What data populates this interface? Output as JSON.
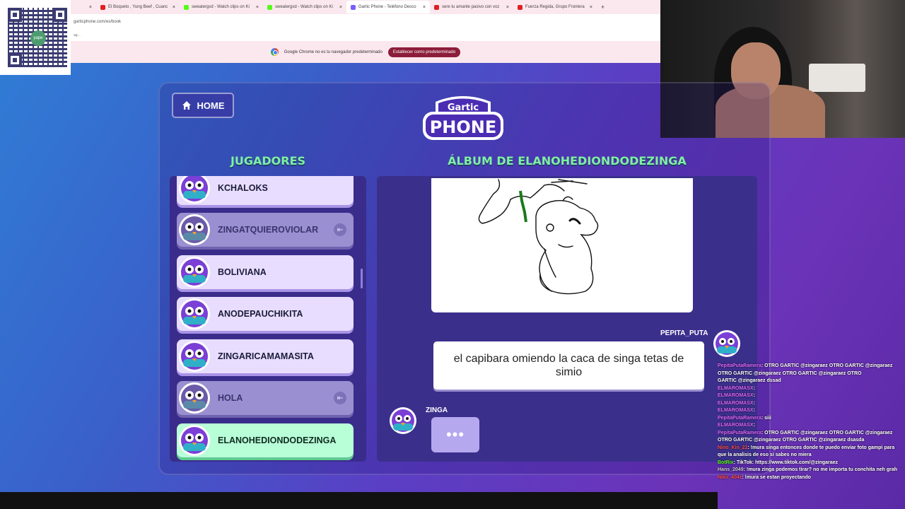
{
  "browser": {
    "tabs": [
      {
        "label": "",
        "active": false,
        "fav": "#888"
      },
      {
        "label": "El Boqueto , Yung Beef , Cuanc",
        "active": false,
        "fav": "#e02020"
      },
      {
        "label": "sweatergxd - Watch clips on Ki",
        "active": false,
        "fav": "#53fc18"
      },
      {
        "label": "sweatergxd - Watch clips on Ki",
        "active": false,
        "fav": "#53fc18"
      },
      {
        "label": "Gartic Phone - Teléfono Desco",
        "active": true,
        "fav": "#7b5cff"
      },
      {
        "label": "sere tu amante pasivo con voz",
        "active": false,
        "fav": "#e02020"
      },
      {
        "label": "Fuerza Regida, Grupo Frontera",
        "active": false,
        "fav": "#e02020"
      }
    ],
    "new_tab": "+",
    "url": "garticphone.com/es/book",
    "bookmarks": "ag...",
    "infobar": {
      "message": "Google Chrome no es tu navegador predeterminado",
      "button": "Establecer como predeterminado"
    }
  },
  "qr": {
    "logo_text": "yape"
  },
  "game": {
    "home_label": "HOME",
    "logo_top": "Gartic",
    "logo_bottom": "PHONE",
    "players_title": "JUGADORES",
    "album_title": "ÁLBUM DE ELANOHEDIONDODEZINGA",
    "players": [
      {
        "name": "KCHALOKS",
        "state": "active"
      },
      {
        "name": "ZINGATQUIEROVIOLAR",
        "state": "left"
      },
      {
        "name": "BOLIVIANA",
        "state": "active"
      },
      {
        "name": "ANODEPAUCHIKITA",
        "state": "active"
      },
      {
        "name": "ZINGARICAMAMASITA",
        "state": "active"
      },
      {
        "name": "HOLA",
        "state": "left"
      },
      {
        "name": "ELANOHEDIONDODEZINGA",
        "state": "me"
      }
    ],
    "exit_icon_label": "⇤",
    "messages": [
      {
        "author": "PEPITA_PUTA",
        "text": "el capibara omiendo la caca de singa tetas de simio"
      },
      {
        "author": "ZINGA",
        "text": "•••"
      }
    ]
  },
  "chat": [
    {
      "user": "PepitaPutaRamera",
      "msg": ": OTRO GARTIC  @zingaraez  OTRO GARTIC  @zingaraez",
      "ucolor": "#e066ff"
    },
    {
      "user": "",
      "msg": "OTRO GARTIC  @zingaraez  OTRO GARTIC  @zingaraez  OTRO",
      "ucolor": "#ffffff"
    },
    {
      "user": "",
      "msg": "GARTIC  @zingaraez  dssad",
      "ucolor": "#ffffff"
    },
    {
      "user": "ELMAROMASX",
      "msg": ": ",
      "ucolor": "#e066ff"
    },
    {
      "user": "ELMAROMASX",
      "msg": ": ",
      "ucolor": "#e066ff"
    },
    {
      "user": "ELMAROMASX",
      "msg": ": ",
      "ucolor": "#e066ff"
    },
    {
      "user": "ELMAROMASX",
      "msg": ": ",
      "ucolor": "#e066ff"
    },
    {
      "user": "PepitaPutaRamera",
      "msg": ": siii",
      "ucolor": "#e066ff"
    },
    {
      "user": "ELMAROMASX",
      "msg": ": ",
      "ucolor": "#e066ff"
    },
    {
      "user": "PepitaPutaRamera",
      "msg": ": OTRO GARTIC  @zingaraez  OTRO GARTIC  @zingaraez",
      "ucolor": "#e066ff"
    },
    {
      "user": "",
      "msg": "OTRO GARTIC  @zingaraez  OTRO GARTIC  @zingaraez  dsasda",
      "ucolor": "#ffffff"
    },
    {
      "user": "Nino_Kin_22",
      "msg": ": !mura singa entonces donde te puedo enviar foto gampi para",
      "ucolor": "#ff4d4d"
    },
    {
      "user": "",
      "msg": "que la analisis de eso si sabes no miera",
      "ucolor": "#ffffff"
    },
    {
      "user": "BotRix",
      "msg": ": TikTok:  https://www.tiktok.com/@zingaraez",
      "ucolor": "#53fc18"
    },
    {
      "user": "Hans_2049",
      "msg": ": !mura zinga podemos tirar? no me importa tu conchita neh grah",
      "ucolor": "#cccccc"
    },
    {
      "user": "Niko_404z",
      "msg": ": !mura se estan proyectando",
      "ucolor": "#ff4d4d"
    }
  ]
}
